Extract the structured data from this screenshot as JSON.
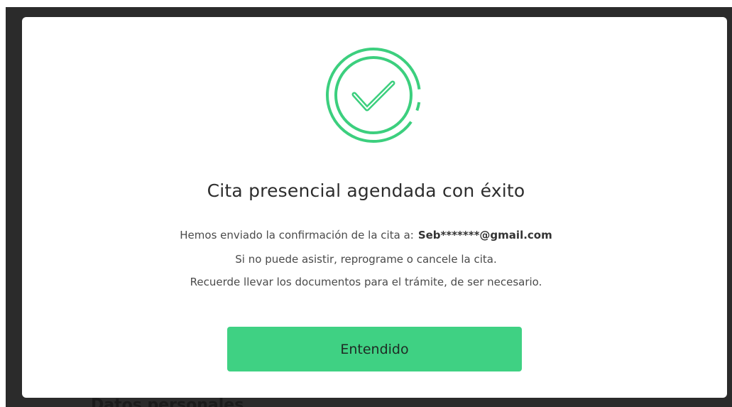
{
  "modal": {
    "title": "Cita presencial agendada con éxito",
    "message_prefix": "Hemos enviado la confirmación de la cita a:",
    "email": "Seb*******@gmail.com",
    "line2": "Si no puede asistir, reprograme o cancele la cita.",
    "line3": "Recuerde llevar los documentos para el trámite, de ser necesario.",
    "button_label": "Entendido",
    "icon": "success-check-circle-icon"
  },
  "background": {
    "partial_heading": "Datos personales"
  },
  "colors": {
    "accent_green": "#3fd183",
    "overlay": "#2b2b2b",
    "icon_green": "#3ccf7e"
  }
}
